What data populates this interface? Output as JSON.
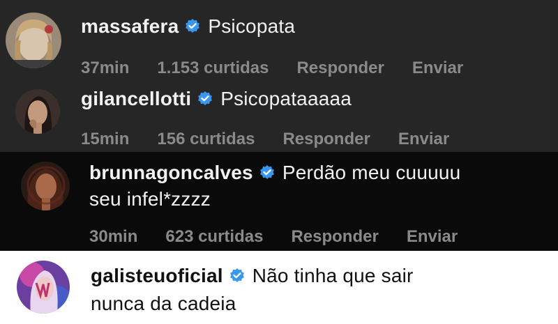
{
  "comments": [
    {
      "username": "massafera",
      "verified": true,
      "text_lines": [
        "Psicopata"
      ],
      "time": "37min",
      "likes": "1.153 curtidas",
      "reply_label": "Responder",
      "send_label": "Enviar"
    },
    {
      "username": "gilancellotti",
      "verified": true,
      "text_lines": [
        "Psicopataaaaa"
      ],
      "time": "15min",
      "likes": "156 curtidas",
      "reply_label": "Responder",
      "send_label": "Enviar"
    },
    {
      "username": "brunnagoncalves",
      "verified": true,
      "text_lines": [
        "Perdão meu cuuuuu",
        "seu infel*zzzz"
      ],
      "time": "30min",
      "likes": "623 curtidas",
      "reply_label": "Responder",
      "send_label": "Enviar"
    },
    {
      "username": "galisteuoficial",
      "verified": true,
      "text_lines": [
        "Não tinha que sair",
        "nunca da cadeia"
      ]
    }
  ],
  "colors": {
    "verified_blue": "#3897f0",
    "dark_background": "#262626",
    "black_background": "#0a0a0a",
    "light_background": "#ffffff",
    "meta_gray": "#8a8a8a"
  }
}
